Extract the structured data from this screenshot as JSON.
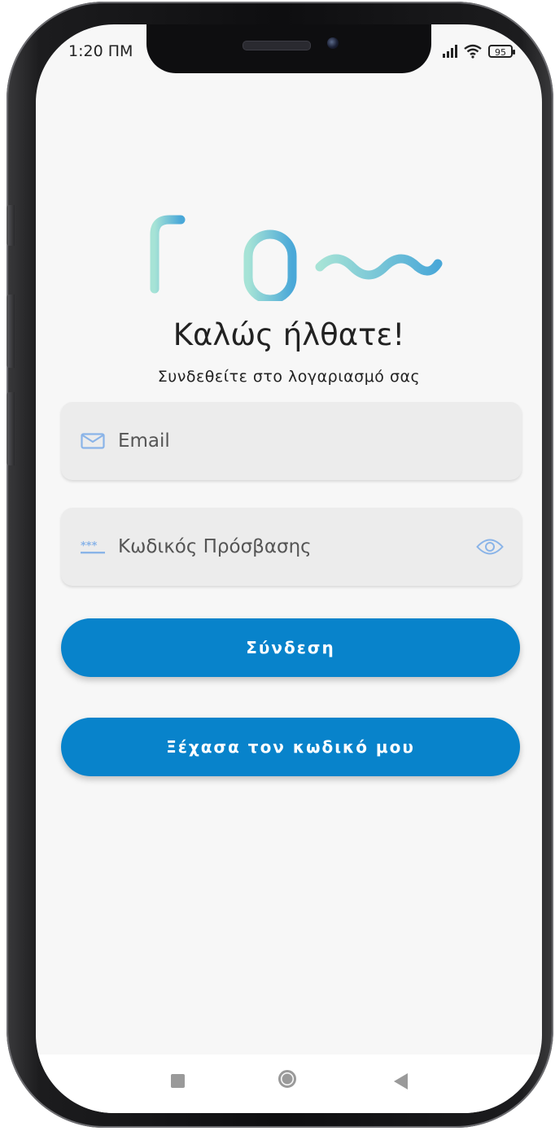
{
  "status_bar": {
    "time": "1:20 ΠΜ",
    "battery": "95"
  },
  "logo": {
    "name": "flow",
    "gradient_start": "#a6e3d6",
    "gradient_end": "#4aa8d8"
  },
  "welcome": {
    "title": "Καλώς ήλθατε!",
    "subtitle": "Συνδεθείτε στο λογαριασμό σας"
  },
  "form": {
    "email_placeholder": "Email",
    "password_placeholder": "Κωδικός Πρόσβασης",
    "password_prefix_icon": "***"
  },
  "buttons": {
    "login": "Σύνδεση",
    "forgot": "Ξέχασα τον κωδικό μου"
  },
  "colors": {
    "primary": "#0883cb",
    "icon_tint": "#8ab4e8",
    "screen_bg": "#f7f7f7",
    "field_bg": "#ececec"
  },
  "nav": {
    "icons": [
      "recent-apps-icon",
      "home-icon",
      "back-icon"
    ]
  }
}
